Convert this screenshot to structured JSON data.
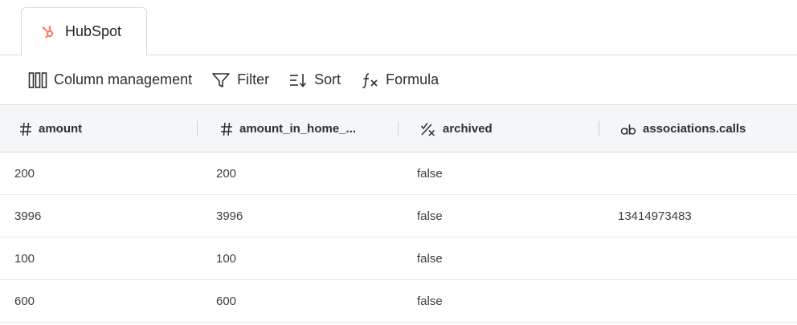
{
  "tabs": [
    {
      "label": "HubSpot",
      "icon": "hubspot-icon",
      "icon_color": "#ff7a59"
    }
  ],
  "toolbar": {
    "column_management": "Column management",
    "filter": "Filter",
    "sort": "Sort",
    "formula": "Formula"
  },
  "table": {
    "columns": [
      {
        "label": "amount",
        "type_icon": "number-type-icon"
      },
      {
        "label": "amount_in_home_...",
        "type_icon": "number-type-icon"
      },
      {
        "label": "archived",
        "type_icon": "boolean-type-icon"
      },
      {
        "label": "associations.calls",
        "type_icon": "text-type-icon"
      }
    ],
    "rows": [
      [
        "200",
        "200",
        "false",
        ""
      ],
      [
        "3996",
        "3996",
        "false",
        "13414973483"
      ],
      [
        "100",
        "100",
        "false",
        ""
      ],
      [
        "600",
        "600",
        "false",
        ""
      ]
    ]
  },
  "colors": {
    "header_bg": "#f4f6f8",
    "border": "#d9dde2",
    "accent": "#ff7a59"
  }
}
